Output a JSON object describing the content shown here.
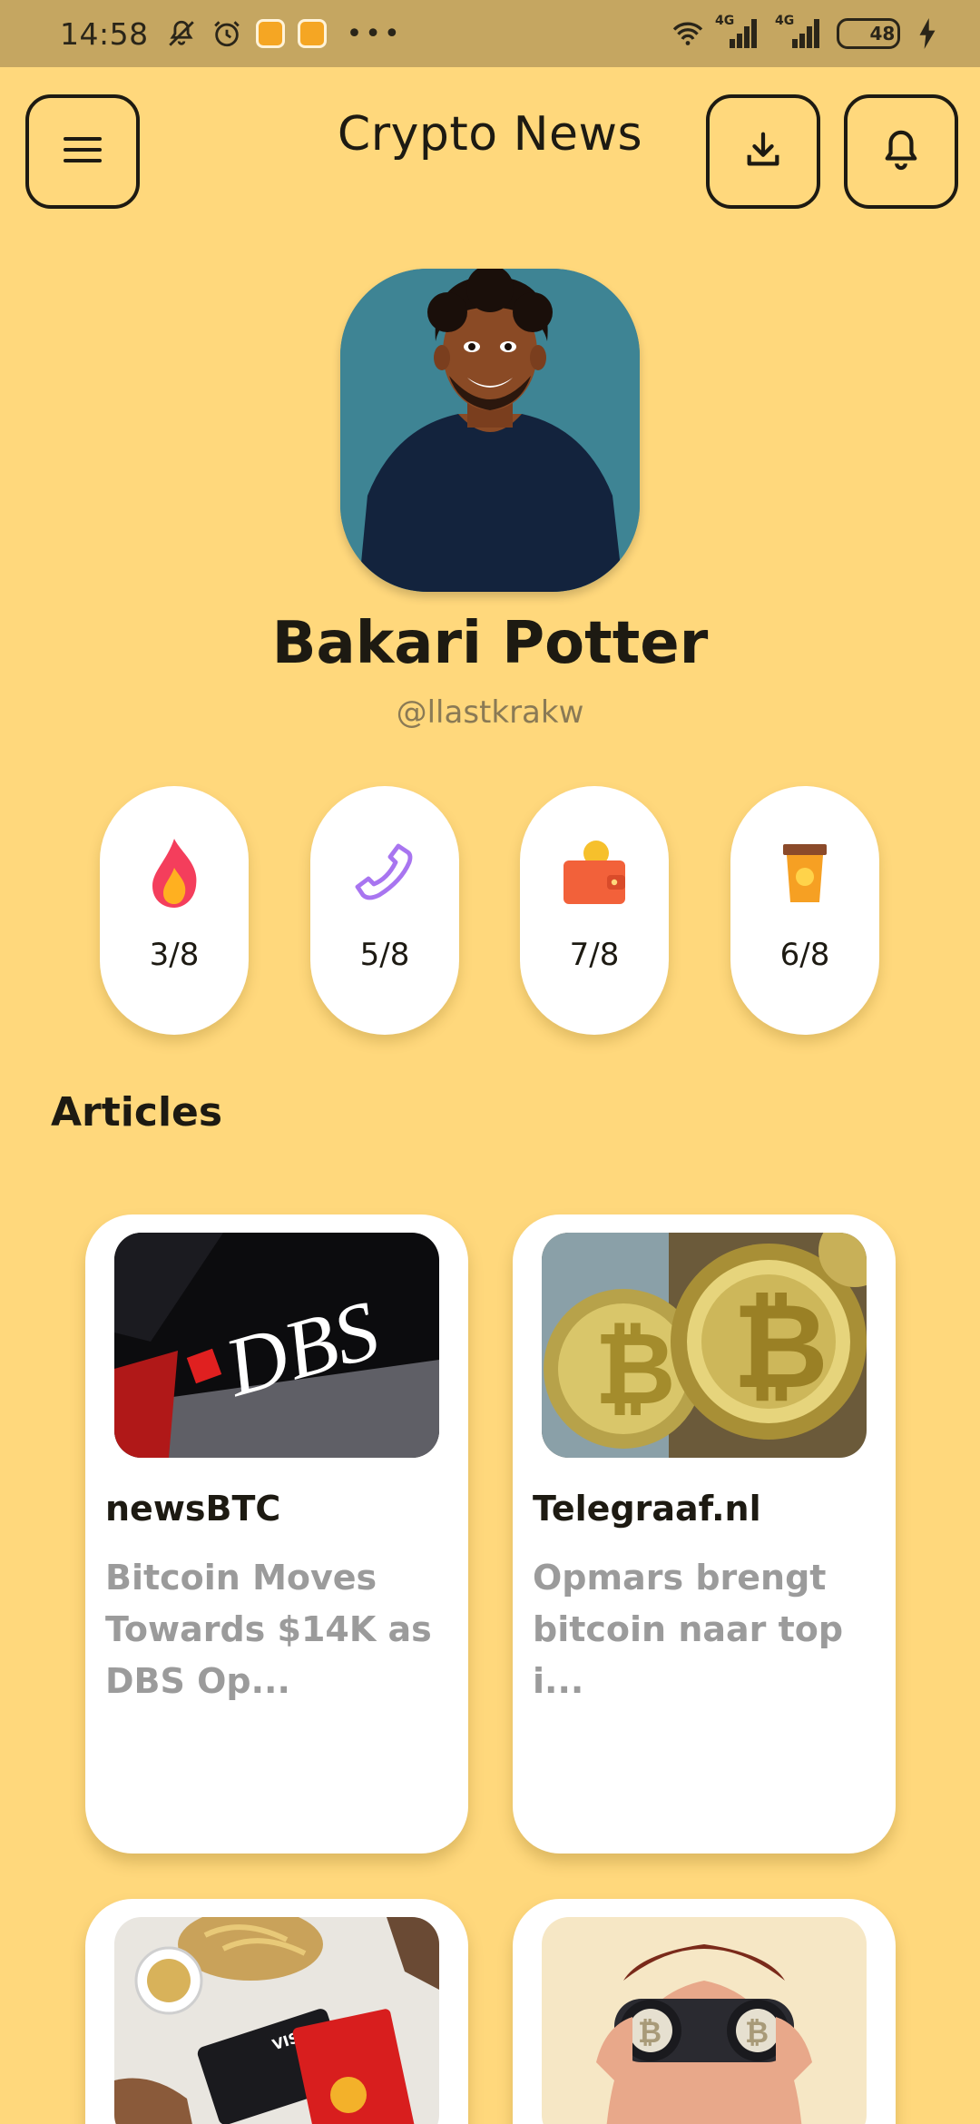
{
  "status_bar": {
    "time": "14:58",
    "network_1": "4G",
    "network_2": "4G",
    "battery_level": 48,
    "battery_text": "48",
    "overflow": "•••"
  },
  "header": {
    "title": "Crypto News",
    "menu_icon": "hamburger-menu-icon",
    "download_icon": "download-icon",
    "notification_icon": "bell-icon"
  },
  "profile": {
    "name": "Bakari Potter",
    "handle": "@llastkrakw"
  },
  "stats": [
    {
      "icon": "flame-icon",
      "value": "3/8"
    },
    {
      "icon": "phone-icon",
      "value": "5/8"
    },
    {
      "icon": "wallet-icon",
      "value": "7/8"
    },
    {
      "icon": "coffee-cup-icon",
      "value": "6/8"
    }
  ],
  "articles_section": {
    "title": "Articles"
  },
  "articles": [
    {
      "source": "newsBTC",
      "excerpt": "Bitcoin Moves Towards $14K as DBS Op...",
      "thumb_text": "DBS"
    },
    {
      "source": "Telegraaf.nl",
      "excerpt": "Opmars brengt bitcoin naar top i...",
      "thumb_text": ""
    },
    {
      "source": "",
      "excerpt": "",
      "thumb_text": "VISA"
    },
    {
      "source": "",
      "excerpt": "",
      "thumb_text": ""
    }
  ],
  "colors": {
    "background": "#FFD87C",
    "status_bar": "#C5A661",
    "card": "#FFFFFF",
    "text": "#1D1A12",
    "muted": "#9B9B9B"
  }
}
